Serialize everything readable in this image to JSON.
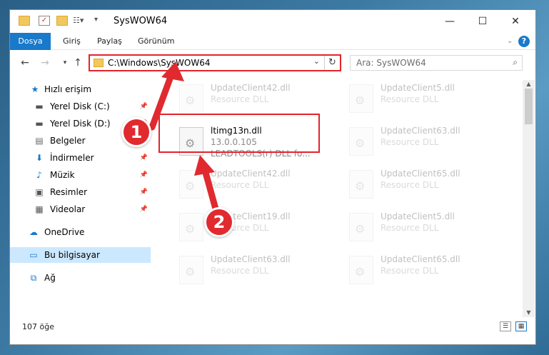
{
  "window": {
    "title": "SysWOW64"
  },
  "ribbon": {
    "tabs": [
      "Dosya",
      "Giriş",
      "Paylaş",
      "Görünüm"
    ]
  },
  "address": {
    "path": "C:\\Windows\\SysWOW64",
    "search_placeholder": "Ara: SysWOW64"
  },
  "sidebar": {
    "items": [
      {
        "label": "Hızlı erişim",
        "icon": "star-icon"
      },
      {
        "label": "Yerel Disk (C:)",
        "icon": "drive-icon"
      },
      {
        "label": "Yerel Disk (D:)",
        "icon": "drive-icon"
      },
      {
        "label": "Belgeler",
        "icon": "documents-icon"
      },
      {
        "label": "İndirmeler",
        "icon": "download-icon"
      },
      {
        "label": "Müzik",
        "icon": "music-icon"
      },
      {
        "label": "Resimler",
        "icon": "pictures-icon"
      },
      {
        "label": "Videolar",
        "icon": "video-icon"
      },
      {
        "label": "OneDrive",
        "icon": "cloud-icon"
      },
      {
        "label": "Bu bilgisayar",
        "icon": "computer-icon"
      },
      {
        "label": "Ağ",
        "icon": "network-icon"
      }
    ]
  },
  "files": {
    "left": [
      {
        "name": "UpdateClient42.dll",
        "desc": "Resource DLL"
      },
      {
        "name": "UpdateClient42.dll",
        "desc": "Resource DLL"
      },
      {
        "name": "UpdateClient19.dll",
        "desc": "Resource DLL"
      },
      {
        "name": "UpdateClient63.dll",
        "desc": "Resource DLL"
      }
    ],
    "right": [
      {
        "name": "UpdateClient5.dll",
        "desc": "Resource DLL"
      },
      {
        "name": "UpdateClient63.dll",
        "desc": "Resource DLL"
      },
      {
        "name": "UpdateClient65.dll",
        "desc": "Resource DLL"
      },
      {
        "name": "UpdateClient5.dll",
        "desc": "Resource DLL"
      },
      {
        "name": "UpdateClient65.dll",
        "desc": "Resource DLL"
      }
    ],
    "selected": {
      "name": "ltimg13n.dll",
      "version": "13.0.0.105",
      "desc": "LEADTOOLS(r) DLL fo..."
    }
  },
  "status": {
    "count": "107 öğe"
  },
  "annotations": {
    "step1": "1",
    "step2": "2",
    "color": "#e02a2f"
  }
}
